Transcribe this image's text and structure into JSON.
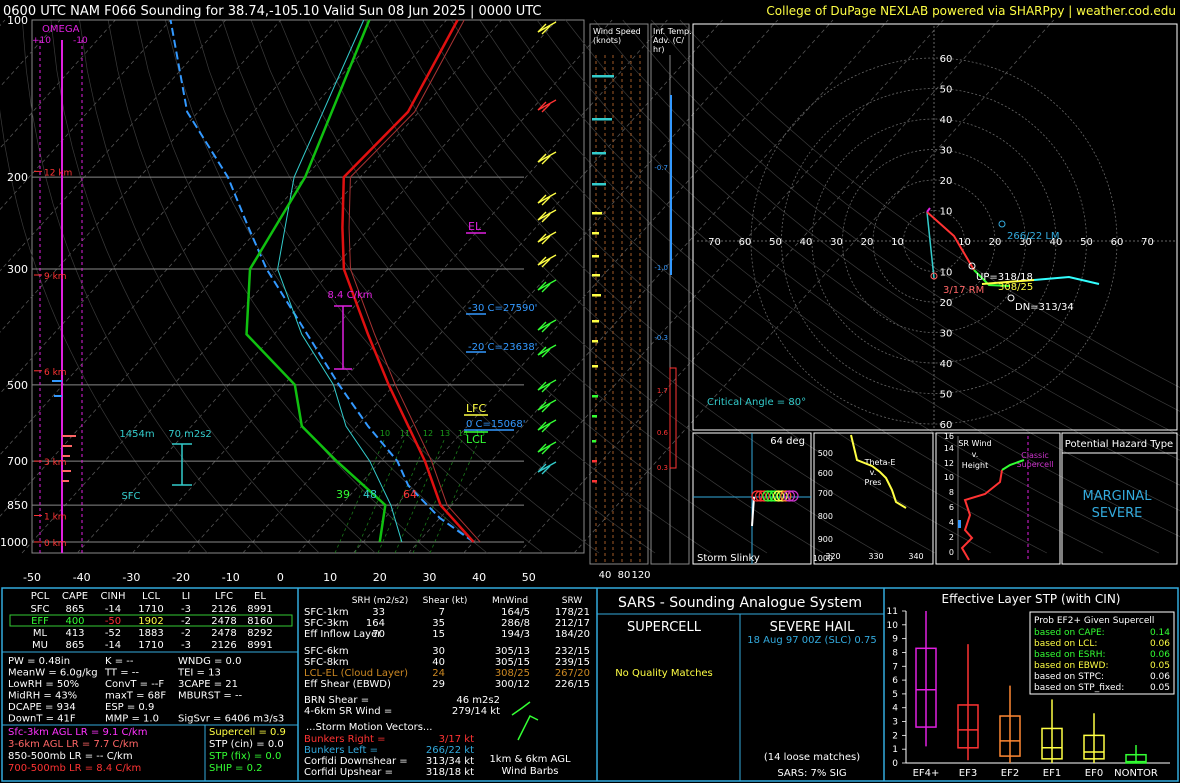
{
  "header": {
    "left": "0600 UTC NAM F066 Sounding for 38.74,-105.10 Valid  Sun 08 Jun 2025 | 0000 UTC",
    "right": "College of DuPage NEXLAB powered via SHARPpy | weather.cod.edu"
  },
  "colors": {
    "temp": "#e01010",
    "dewp": "#10c010",
    "parcel": "#ffffff",
    "wetbulb": "#33ccff",
    "virt": "#cc2222",
    "accent": "#ffff44",
    "panel_border": "#33aadd",
    "magenta": "#e020e0"
  },
  "chart_data": {
    "type": "skew-t",
    "pressure_ticks": [
      "100",
      "200",
      "300",
      "500",
      "700",
      "850",
      "1000"
    ],
    "pressure_levels": [
      100,
      200,
      300,
      500,
      700,
      850,
      1000
    ],
    "temp_ticks": [
      "-50",
      "-40",
      "-30",
      "-20",
      "-10",
      "0",
      "10",
      "20",
      "30",
      "40",
      "50"
    ],
    "temp_tick_values": [
      -50,
      -40,
      -30,
      -20,
      -10,
      0,
      10,
      20,
      30,
      40,
      50
    ],
    "pressure_range": [
      1050,
      100
    ],
    "temperature_range_c": [
      -50,
      50
    ],
    "height_labels": [
      "12 km",
      "9 km",
      "6 km",
      "3 km",
      "1 km",
      "0 km"
    ],
    "height_pressures": [
      195,
      308,
      470,
      700,
      890,
      1000
    ],
    "omega_label": "OMEGA",
    "omega_ticks": [
      "+10",
      "-10"
    ],
    "mixing_ratio_labels": [
      "10",
      "11",
      "12",
      "13",
      "14",
      "15"
    ],
    "sfc_label": "SFC",
    "temp_profile": [
      [
        1000,
        30
      ],
      [
        850,
        18
      ],
      [
        700,
        8
      ],
      [
        500,
        -11
      ],
      [
        400,
        -23
      ],
      [
        300,
        -38
      ],
      [
        250,
        -45
      ],
      [
        200,
        -53
      ],
      [
        150,
        -52
      ],
      [
        100,
        -58
      ]
    ],
    "dewpoint_profile": [
      [
        1000,
        13
      ],
      [
        850,
        8
      ],
      [
        700,
        -8
      ],
      [
        600,
        -20
      ],
      [
        500,
        -28
      ],
      [
        400,
        -45
      ],
      [
        300,
        -55
      ],
      [
        200,
        -60
      ],
      [
        100,
        -74
      ]
    ],
    "annotations": {
      "lapse_rate": "8.4 C/km",
      "el": "EL",
      "lfc": "LFC",
      "lcl": "LCL",
      "zero_c": "0 C=15068'",
      "m20_c": "-20 C=23638'",
      "m30_c": "-30 C=27590'",
      "sfc_t": "64",
      "sfc_td": "39",
      "sfc_tw": "48",
      "eff_layer_height": "1454m",
      "eff_layer_srh": "70 m2s2"
    }
  },
  "wind_speed_panel": {
    "title": "Wind Speed (knots)",
    "ticks": [
      "40",
      "80",
      "120"
    ]
  },
  "inf_temp_panel": {
    "title": "Inf. Temp. Adv. (C/hr)",
    "labels": [
      "-0.7",
      "-1.0",
      "-0.3",
      "1.7",
      "0.6",
      "0.3"
    ]
  },
  "hodograph": {
    "ring_labels": [
      "10",
      "20",
      "30",
      "40",
      "50",
      "60"
    ],
    "axis_labels_left": [
      "70",
      "60",
      "50",
      "40",
      "30",
      "20",
      "10"
    ],
    "axis_labels_right": [
      "10",
      "20",
      "30",
      "40",
      "50",
      "60",
      "70"
    ],
    "critical_angle": "Critical Angle = 80°",
    "lm": "266/22 LM",
    "up": "UP=318/18",
    "rm": "3/17 RM",
    "dn": "DN=313/34",
    "mean": "308/25"
  },
  "storm_slinky": {
    "deg": "64 deg",
    "title": "Storm Slinky"
  },
  "theta_e": {
    "label": "Theta-E v. Pres",
    "x_ticks": [
      "320",
      "330",
      "340"
    ],
    "y_ticks": [
      "500",
      "600",
      "700",
      "800",
      "900",
      "1000"
    ]
  },
  "sr_wind": {
    "label": "SR Wind v. Height",
    "note": "Classic Supercell",
    "y_ticks": [
      "16",
      "14",
      "12",
      "10",
      "8",
      "6",
      "4",
      "2",
      "0"
    ]
  },
  "hazard": {
    "title": "Potential Hazard Type",
    "value1": "MARGINAL",
    "value2": "SEVERE"
  },
  "parcel_table": {
    "headers": [
      "PCL",
      "CAPE",
      "CINH",
      "LCL",
      "LI",
      "LFC",
      "EL"
    ],
    "rows": [
      [
        "SFC",
        "865",
        "-14",
        "1710",
        "-3",
        "2126",
        "8991"
      ],
      [
        "EFF",
        "400",
        "-50",
        "1902",
        "-2",
        "2478",
        "8160"
      ],
      [
        "ML",
        "413",
        "-52",
        "1883",
        "-2",
        "2478",
        "8292"
      ],
      [
        "MU",
        "865",
        "-14",
        "1710",
        "-3",
        "2126",
        "8991"
      ]
    ]
  },
  "indices": [
    [
      "PW = 0.48in",
      "K = --",
      "WNDG = 0.0"
    ],
    [
      "MeanW = 6.0g/kg",
      "TT = --",
      "TEI = 13"
    ],
    [
      "LowRH = 50%",
      "ConvT = --F",
      "3CAPE = 21"
    ],
    [
      "MidRH = 43%",
      "maxT = 68F",
      "MBURST = --"
    ],
    [
      "DCAPE = 934",
      "ESP = 0.9",
      ""
    ],
    [
      "DownT = 41F",
      "MMP = 1.0",
      "SigSvr = 6406 m3/s3"
    ]
  ],
  "lapse_rates": [
    "Sfc-3km AGL LR = 9.1 C/km",
    "3-6km AGL LR = 7.7 C/km",
    "850-500mb LR = -- C/km",
    "700-500mb LR = 8.4 C/km"
  ],
  "composites": [
    "Supercell = 0.9",
    "STP (cin) = 0.0",
    "STP (fix) = 0.0",
    "SHIP = 0.2"
  ],
  "kinematics": {
    "headers": [
      "SRH (m2/s2)",
      "Shear (kt)",
      "MnWind",
      "SRW"
    ],
    "rows": [
      [
        "SFC-1km",
        "33",
        "7",
        "164/5",
        "178/21"
      ],
      [
        "SFC-3km",
        "164",
        "35",
        "286/8",
        "212/17"
      ],
      [
        "Eff Inflow Layer",
        "70",
        "15",
        "194/3",
        "184/20"
      ],
      [
        "SFC-6km",
        "",
        "30",
        "305/13",
        "232/15"
      ],
      [
        "SFC-8km",
        "",
        "40",
        "305/15",
        "239/15"
      ],
      [
        "LCL-EL (Cloud Layer)",
        "",
        "24",
        "308/25",
        "267/20"
      ],
      [
        "Eff Shear (EBWD)",
        "",
        "29",
        "300/12",
        "226/15"
      ]
    ],
    "brn": [
      "BRN Shear =",
      "46 m2s2"
    ],
    "srwind": [
      "4-6km SR Wind =",
      "279/14 kt"
    ],
    "storm_motion_title": "...Storm Motion Vectors...",
    "motions": [
      [
        "Bunkers Right =",
        "3/17 kt"
      ],
      [
        "Bunkers Left =",
        "266/22 kt"
      ],
      [
        "Corfidi Downshear =",
        "313/34 kt"
      ],
      [
        "Corfidi Upshear =",
        "318/18 kt"
      ]
    ],
    "barb_label1": "1km & 6km AGL",
    "barb_label2": "Wind Barbs"
  },
  "sars": {
    "title": "SARS - Sounding Analogue System",
    "supercell": "SUPERCELL",
    "severe_hail": "SEVERE HAIL",
    "match": "18 Aug 97 00Z (SLC)  0.75",
    "no_match": "No Quality Matches",
    "loose": "(14 loose matches)",
    "sig": "SARS: 7% SIG"
  },
  "stp_box": {
    "title": "Effective Layer STP (with CIN)",
    "legend_title": "Prob EF2+ Given Supercell",
    "legend": [
      [
        "based on CAPE:",
        "0.14"
      ],
      [
        "based on LCL:",
        "0.06"
      ],
      [
        "based on ESRH:",
        "0.06"
      ],
      [
        "based on EBWD:",
        "0.05"
      ],
      [
        "based on STPC:",
        "0.06"
      ],
      [
        "based on STP_fixed:",
        "0.05"
      ]
    ],
    "y_ticks": [
      "11",
      "10",
      "9",
      "8",
      "7",
      "6",
      "5",
      "4",
      "3",
      "2",
      "1",
      "0"
    ],
    "categories": [
      "EF4+",
      "EF3",
      "EF2",
      "EF1",
      "EF0",
      "NONTOR"
    ]
  }
}
